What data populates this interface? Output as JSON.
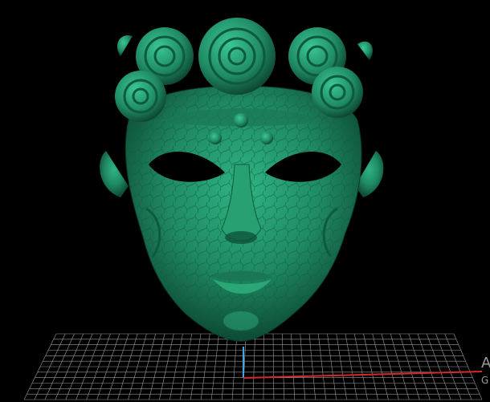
{
  "viewport": {
    "background": "#000000",
    "model": {
      "name_icon": "mask-icon",
      "color": "#1f8a63"
    },
    "grid": {
      "color": "#9a9a9a",
      "x_axis_color": "#d32a2a",
      "z_axis_color": "#3fa7e0"
    }
  },
  "watermark": {
    "line1": "A",
    "line2": "G"
  }
}
